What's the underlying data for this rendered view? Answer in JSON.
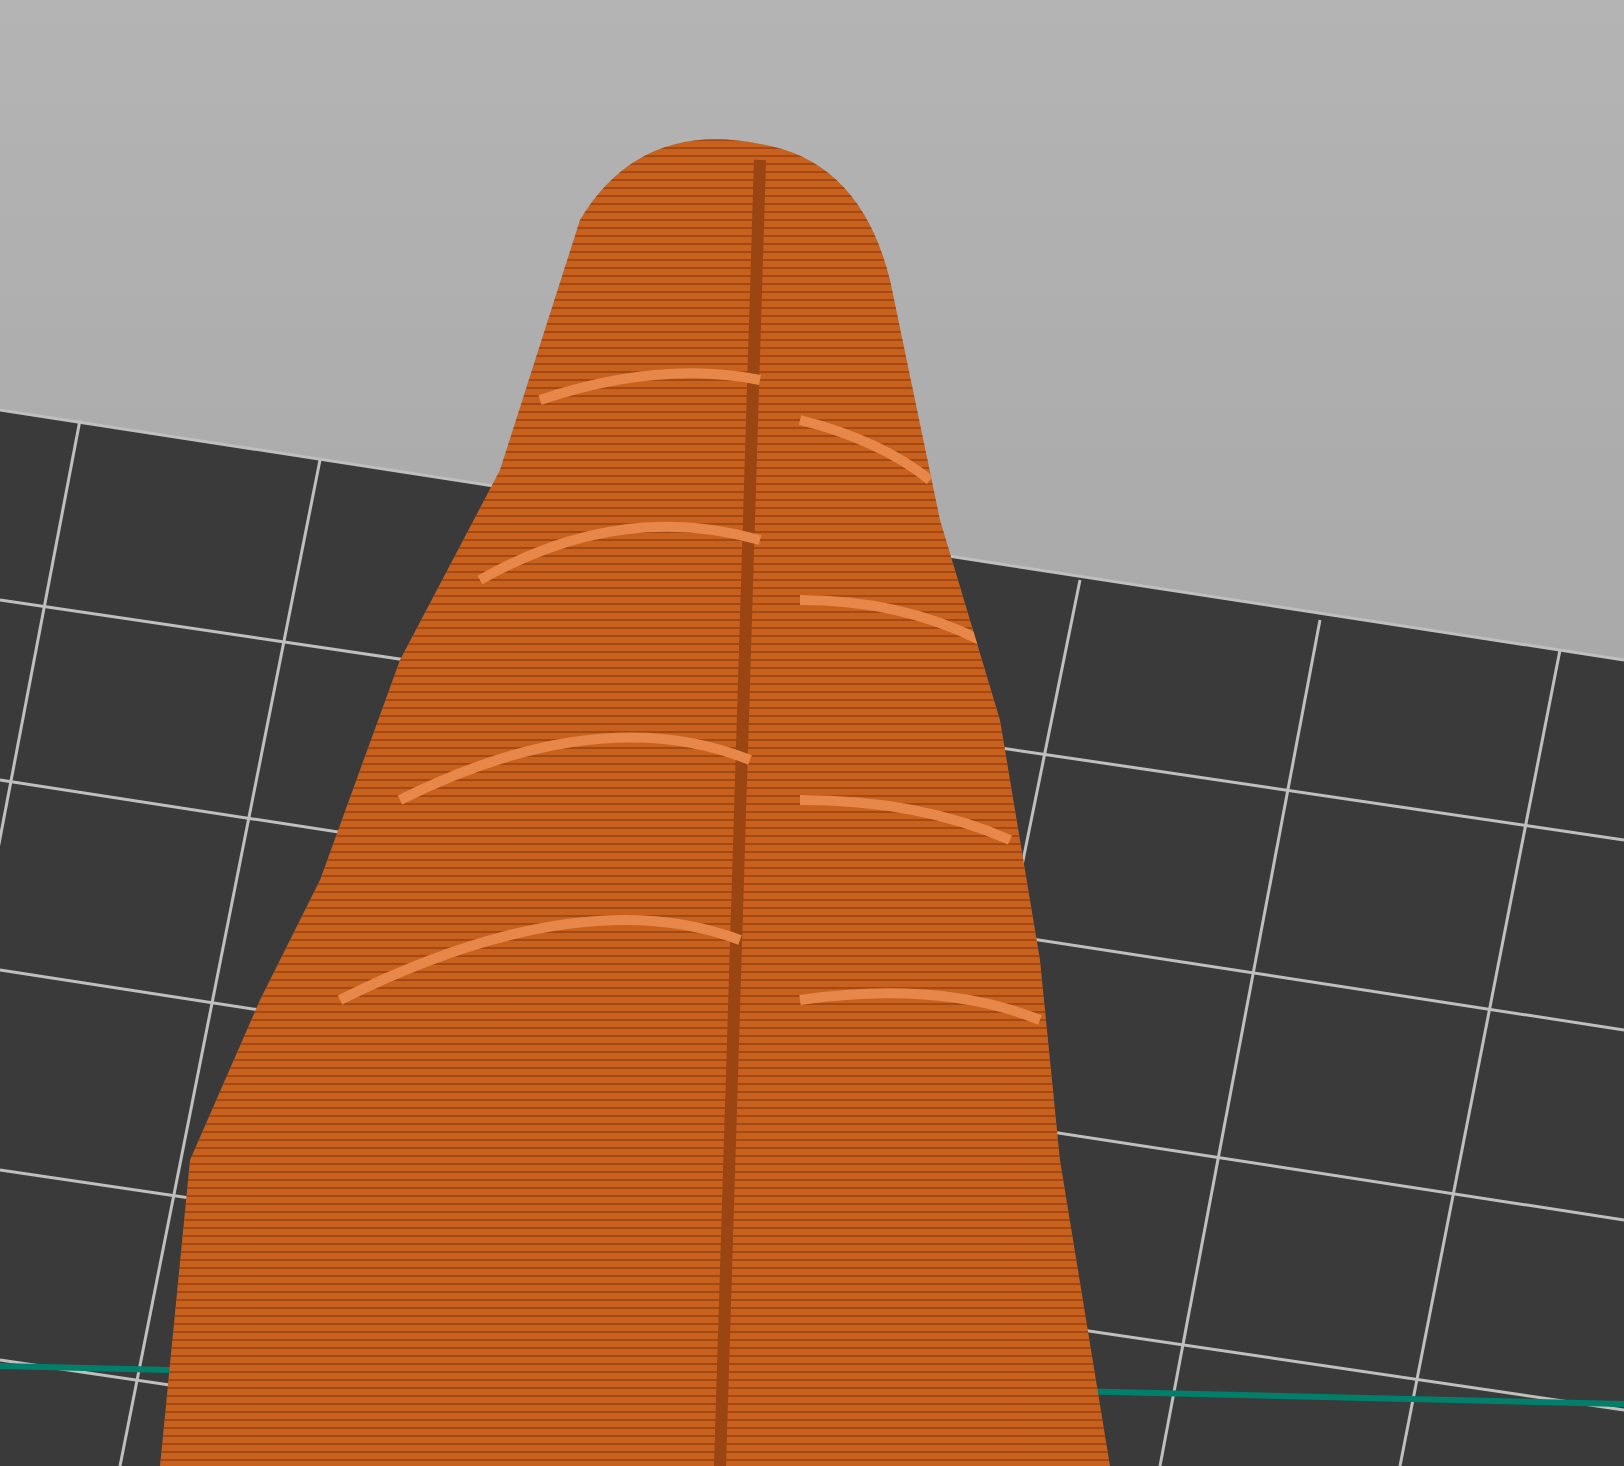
{
  "viewport": {
    "kind": "sliced-preview"
  }
}
